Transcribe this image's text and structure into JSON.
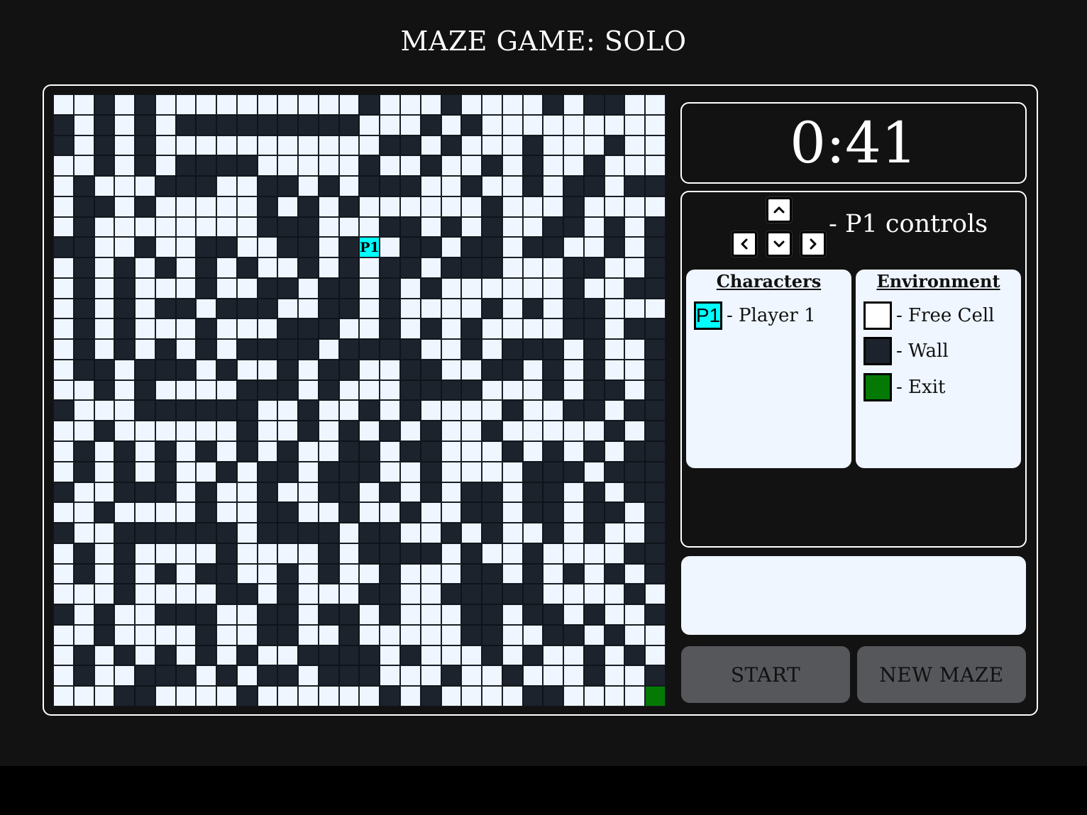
{
  "header": {
    "title": "MAZE GAME: SOLO"
  },
  "timer": {
    "value": "0:41"
  },
  "controls": {
    "label": "- P1 controls",
    "keys": [
      "arrow-up",
      "arrow-left",
      "arrow-down",
      "arrow-right"
    ]
  },
  "legend": {
    "characters": {
      "title": "Characters",
      "items": [
        {
          "tag": "P1",
          "label": "- Player 1",
          "color": "#00ffff"
        }
      ]
    },
    "environment": {
      "title": "Environment",
      "items": [
        {
          "label": "- Free Cell",
          "color": "#ffffff"
        },
        {
          "label": "- Wall",
          "color": "#1c232d"
        },
        {
          "label": "- Exit",
          "color": "#047a04"
        }
      ]
    }
  },
  "message": "",
  "buttons": {
    "start": "START",
    "new_maze": "NEW MAZE"
  },
  "maze": {
    "rows": 30,
    "cols": 30,
    "player": {
      "tag": "P1",
      "row": 7,
      "col": 15
    },
    "exit": {
      "row": 29,
      "col": 29
    },
    "grid": [
      "..#.#..........#...#....#.##..",
      "#.#.#.#########...#.#.........",
      "#.#.#...........##.#...#...#..",
      "..#.#.####.....#..#..#.#..#...",
      ".#...###..##.#.###..#..#.##.##",
      ".##.#.....#.#.#......#...#....",
      ".#........###...##.#.#..##.#.#",
      "##..#..##..##.##.##.##.##..#.#",
      ".#.#.#.#.#..#.#.##.###...##..#",
      ".#.#...#..##.##.#.#......#..##",
      ".#.#.##.###..##.#....#.#.##...",
      ".#.#...#...###..#.#.#....##.##",
      ".#.#.#.#.####.####..#.###.#..#",
      ".##.###.#..#.##..##..##.#.#..#",
      "..#.#....###.#...####...#.##.#",
      "#...######..#..#.#....#..##.##",
      "..#......#..#.#.#.#..#.....#.#",
      ".#.#.#.#.#.#..##.##...#.#.#.##",
      ".#.#.#..#.##.###..#....###.###",
      "#..###.#..#..##.#.#.##.##.#.##",
      "..#....#..##..#..#..##.##.##.#",
      "#..######.####.##..#.#..#.#..#",
      ".#.#....#....#.####.#..#....##",
      ".#.#.#.##..#.#..#...##.#.#.#.#",
      "...#....##.#...##..#####....#.",
      "#.#..###..##.##.#...##.##.#..#",
      "..#....#..##..#.....##..##.#..",
      ".#.#.#.#.#..####.#...#.#..#.#.",
      ".#..###.#.##.###...#..#...#..#",
      "...##....#......#.#....##....E"
    ]
  }
}
